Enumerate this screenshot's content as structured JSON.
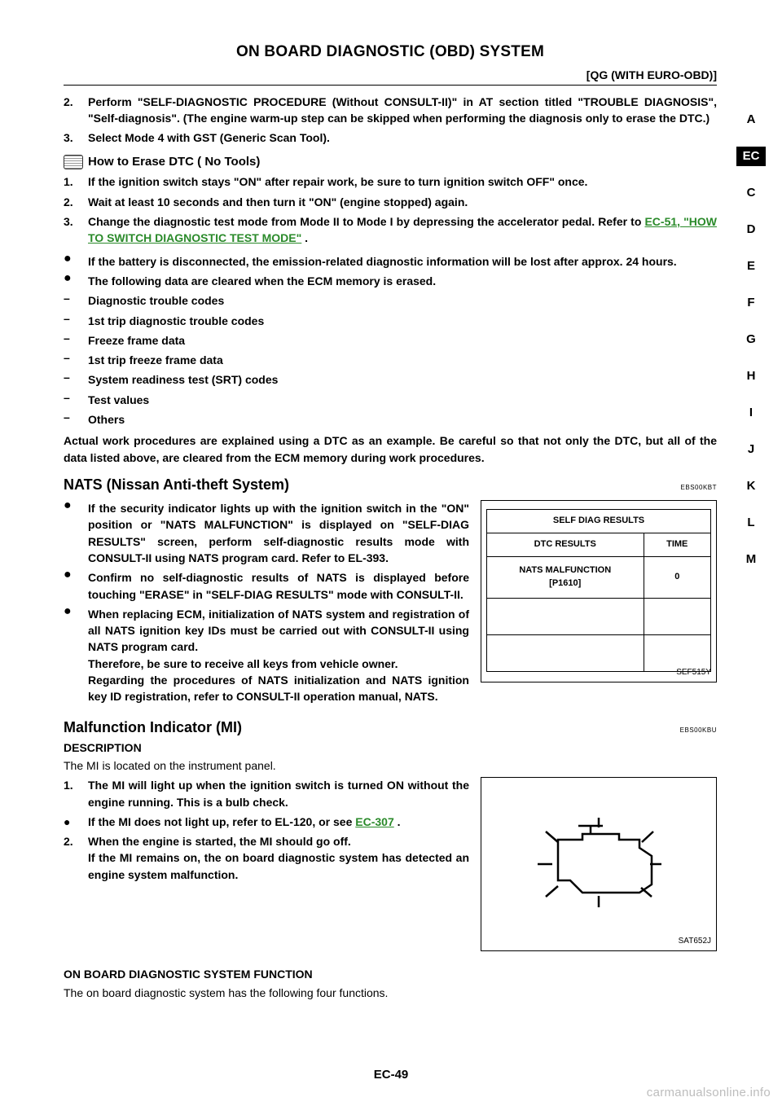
{
  "header": {
    "title": "ON BOARD DIAGNOSTIC (OBD) SYSTEM",
    "subtitle": "[QG (WITH EURO-OBD)]"
  },
  "side_tabs": [
    "A",
    "EC",
    "C",
    "D",
    "E",
    "F",
    "G",
    "H",
    "I",
    "J",
    "K",
    "L",
    "M"
  ],
  "active_tab": "EC",
  "top_steps": [
    "Perform \"SELF-DIAGNOSTIC PROCEDURE (Without CONSULT-II)\" in AT section titled \"TROUBLE DIAGNOSIS\", \"Self-diagnosis\". (The engine warm-up step can be skipped when performing the diagnosis only to erase the DTC.)",
    "Select Mode 4 with GST (Generic Scan Tool)."
  ],
  "erase_heading": "How to Erase DTC ( No Tools)",
  "erase_steps": [
    "If the ignition switch stays \"ON\" after repair work, be sure to turn ignition switch OFF\" once.",
    "Wait at least 10 seconds and then turn it \"ON\" (engine stopped) again.",
    "Change the diagnostic test mode from Mode II to Mode I by depressing the accelerator pedal. Refer to"
  ],
  "erase_link": "EC-51, \"HOW TO SWITCH DIAGNOSTIC TEST MODE\"",
  "erase_bullets": [
    "If the battery is disconnected, the emission-related diagnostic information will be lost after approx. 24 hours.",
    "The following data are cleared when the ECM memory is erased."
  ],
  "erase_dashes": [
    "Diagnostic trouble codes",
    "1st trip diagnostic trouble codes",
    "Freeze frame data",
    "1st trip freeze frame data",
    "System readiness test (SRT) codes",
    "Test values",
    "Others"
  ],
  "erase_footer": "Actual work procedures are explained using a DTC as an example. Be careful so that not only the DTC, but all of the data listed above, are cleared from the ECM memory during work procedures.",
  "nats": {
    "title": "NATS (Nissan Anti-theft System)",
    "code": "EBS00KBT",
    "bullets": [
      "If the security indicator lights up with the ignition switch in the \"ON\" position or \"NATS MALFUNCTION\" is displayed on \"SELF-DIAG RESULTS\" screen, perform self-diagnostic results mode with CONSULT-II using NATS program card. Refer to EL-393.",
      "Confirm no self-diagnostic results of NATS is displayed before touching \"ERASE\" in \"SELF-DIAG RESULTS\" mode with CONSULT-II.",
      "When replacing ECM, initialization of NATS system and registration of all NATS ignition key IDs must be carried out with CONSULT-II using NATS program card.\nTherefore, be sure to receive all keys from vehicle owner.\nRegarding the procedures of NATS initialization and NATS ignition key ID registration, refer to CONSULT-II operation manual, NATS."
    ],
    "fig": {
      "title": "SELF DIAG RESULTS",
      "col1": "DTC RESULTS",
      "col2": "TIME",
      "row1a": "NATS MALFUNCTION\n[P1610]",
      "row1b": "0",
      "label": "SEF515Y"
    }
  },
  "mi": {
    "title": "Malfunction Indicator (MI)",
    "code": "EBS00KBU",
    "desc_h": "DESCRIPTION",
    "intro": "The MI is located on the instrument panel.",
    "items": [
      {
        "n": "1.",
        "t": "The MI will light up when the ignition switch is turned ON without the engine running. This is a bulb check."
      },
      {
        "n": "●",
        "t": "If the MI does not light up, refer to EL-120, or see ",
        "link": "EC-307",
        "tail": " ."
      },
      {
        "n": "2.",
        "t": "When the engine is started, the MI should go off.\nIf the MI remains on, the on board diagnostic system has detected an engine system malfunction."
      }
    ],
    "fig_label": "SAT652J",
    "func_h": "ON BOARD DIAGNOSTIC SYSTEM FUNCTION",
    "func_p": "The on board diagnostic system has the following four functions."
  },
  "footer": "EC-49",
  "watermark": "carmanualsonline.info"
}
